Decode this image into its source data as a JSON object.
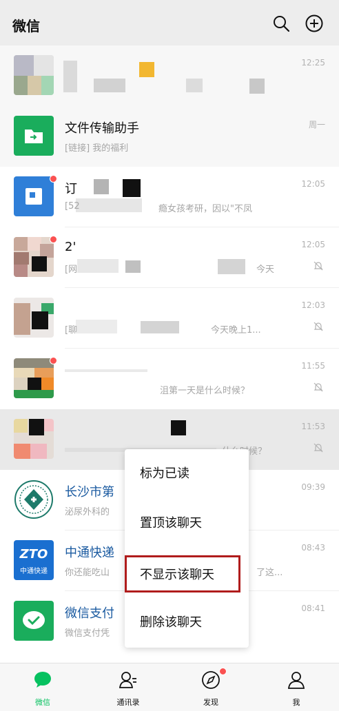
{
  "header": {
    "title": "微信"
  },
  "icons": {
    "search": "search-icon",
    "add": "plus-circle-icon",
    "mute": "bell-off-icon"
  },
  "colors": {
    "accent": "#07c160",
    "badge": "#fa5151",
    "highlight": "#b01c1c"
  },
  "chats": [
    {
      "name": "",
      "preview": "",
      "time": "12:25"
    },
    {
      "name": "文件传输助手",
      "preview": "[链接] 我的福利",
      "time": "周一"
    },
    {
      "name": "订",
      "preview": "[52",
      "preview_tail": "瘾女孩考研，因以\"不凤",
      "time": "12:05"
    },
    {
      "name": "2'",
      "preview": "[网",
      "preview_tail": "今天",
      "time": "12:05"
    },
    {
      "name": "",
      "preview": "[聊",
      "preview_tail": "今天晚上1...",
      "time": "12:03"
    },
    {
      "name": "",
      "preview": "",
      "preview_tail": "沮第一天是什么时候？",
      "time": "11:55"
    },
    {
      "name": "",
      "preview": "",
      "preview_tail": "什么时候？",
      "time": "11:53"
    },
    {
      "name": "长沙市第",
      "preview": "泌尿外科的",
      "time": "09:39"
    },
    {
      "name": "中通快递",
      "preview": "你还能吃山",
      "preview_tail": "了这...",
      "time": "08:43"
    },
    {
      "name": "微信支付",
      "preview": "微信支付凭",
      "time": "08:41"
    }
  ],
  "context_menu": [
    "标为已读",
    "置顶该聊天",
    "不显示该聊天",
    "删除该聊天"
  ],
  "avatars": {
    "zto_top": "ZTO",
    "zto_bottom": "中通快递"
  },
  "tabs": [
    {
      "label": "微信",
      "icon": "chat-bubble-icon"
    },
    {
      "label": "通讯录",
      "icon": "contacts-icon"
    },
    {
      "label": "发现",
      "icon": "compass-icon"
    },
    {
      "label": "我",
      "icon": "person-icon"
    }
  ]
}
